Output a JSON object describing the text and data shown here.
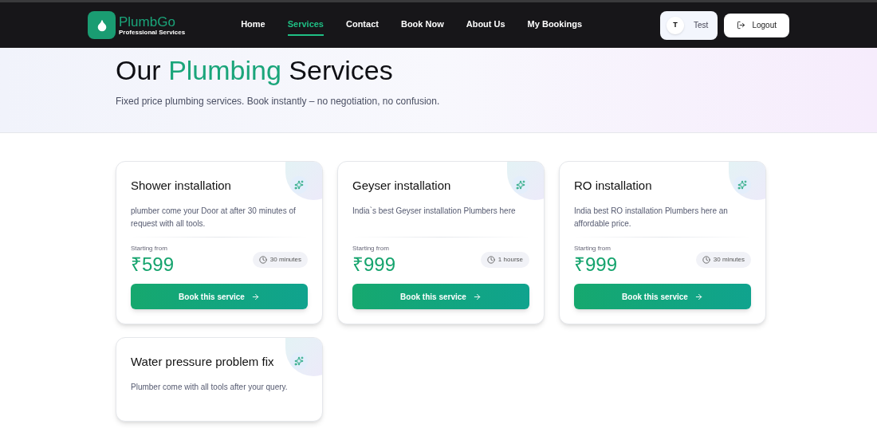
{
  "brand": {
    "name": "PlumbGo",
    "tagline": "Professional Services"
  },
  "nav": [
    {
      "label": "Home",
      "selected": false
    },
    {
      "label": "Services",
      "selected": true
    },
    {
      "label": "Contact",
      "selected": false
    },
    {
      "label": "Book Now",
      "selected": false
    },
    {
      "label": "About Us",
      "selected": false
    },
    {
      "label": "My Bookings",
      "selected": false
    }
  ],
  "user": {
    "initial": "T",
    "name": "Test"
  },
  "logout": "Logout",
  "hero": {
    "title": [
      {
        "text": "Our ",
        "highlight": false
      },
      {
        "text": "Plumbing",
        "highlight": true
      },
      {
        "text": " Services",
        "highlight": false
      }
    ],
    "subtitle": "Fixed price plumbing services. Book instantly – no negotiation, no confusion."
  },
  "services": [
    {
      "title": "Shower installation",
      "description": "plumber come your Door at after 30 minutes of request with all tools.",
      "price_label": "Starting from",
      "price": "₹599",
      "duration": "30 minutes",
      "button": "Book this service"
    },
    {
      "title": "Geyser installation",
      "description": "India`s best Geyser installation Plumbers here",
      "price_label": "Starting from",
      "price": "₹999",
      "duration": "1 hourse",
      "button": "Book this service"
    },
    {
      "title": "RO installation",
      "description": "India best RO installation Plumbers here an affordable price.",
      "price_label": "Starting from",
      "price": "₹999",
      "duration": "30 minutes",
      "button": "Book this service"
    },
    {
      "title": "Water pressure problem fix",
      "description": "Plumber come with all tools after your query."
    }
  ]
}
